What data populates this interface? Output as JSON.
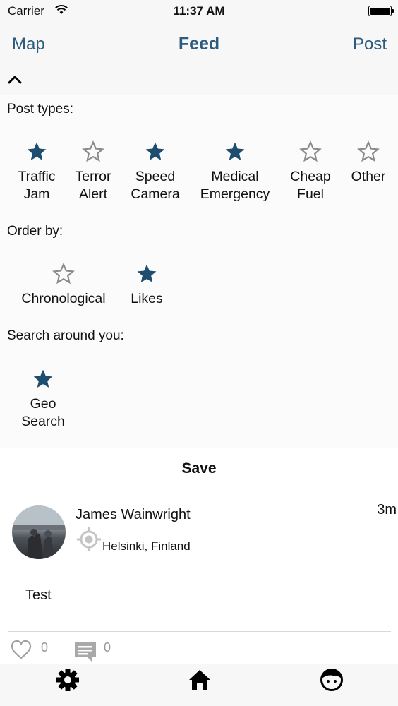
{
  "status_bar": {
    "carrier": "Carrier",
    "time": "11:37 AM"
  },
  "nav": {
    "left_label": "Map",
    "title": "Feed",
    "right_label": "Post"
  },
  "filters": {
    "post_types_label": "Post types:",
    "post_types": [
      {
        "label": "Traffic\nJam",
        "selected": true
      },
      {
        "label": "Terror\nAlert",
        "selected": false
      },
      {
        "label": "Speed\nCamera",
        "selected": true
      },
      {
        "label": "Medical\nEmergency",
        "selected": true
      },
      {
        "label": "Cheap\nFuel",
        "selected": false
      },
      {
        "label": "Other",
        "selected": false
      }
    ],
    "order_by_label": "Order by:",
    "order_by": [
      {
        "label": "Chronological",
        "selected": false
      },
      {
        "label": "Likes",
        "selected": true
      }
    ],
    "search_label": "Search around you:",
    "search_options": [
      {
        "label": "Geo\nSearch",
        "selected": true
      }
    ]
  },
  "save_label": "Save",
  "post": {
    "author": "James Wainwright",
    "age": "3m",
    "location": "Helsinki, Finland",
    "body": "Test",
    "likes": "0",
    "comments": "0"
  },
  "colors": {
    "accent": "#2d5b7e",
    "star_filled": "#1e4d6f",
    "star_outline": "#8a8a8a"
  },
  "icons": {
    "tabs": [
      "gear-icon",
      "home-icon",
      "face-icon"
    ]
  }
}
